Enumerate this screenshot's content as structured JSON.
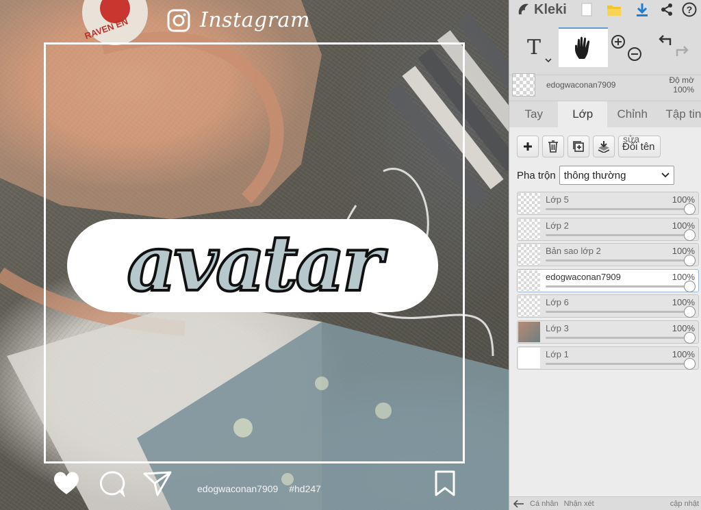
{
  "canvas": {
    "header": {
      "icon": "instagram-icon",
      "label": "Instagram"
    },
    "patch_text": "RAVEN EN",
    "sticker_text": "avatar",
    "footer": {
      "username": "edogwaconan7909",
      "hashtag": "#hd247"
    }
  },
  "panel": {
    "brand": "Kleki",
    "topbar_icons": [
      "new-file-icon",
      "folder-icon",
      "download-icon",
      "share-icon",
      "help-icon"
    ],
    "tools": {
      "text_glyph": "T"
    },
    "layer_header": {
      "name": "edogwaconan7909",
      "opacity_label": "Độ mờ",
      "opacity_value": "100%"
    },
    "tabs": [
      {
        "label": "Tay"
      },
      {
        "label": "Lớp"
      },
      {
        "label": "Chỉnh"
      },
      {
        "label": "Tập tin"
      }
    ],
    "rename_button": {
      "sub": "sửa",
      "label": "Đổi tên"
    },
    "blend": {
      "label": "Pha trộn",
      "value": "thông thường"
    },
    "layers": [
      {
        "name": "Lớp 5",
        "opacity": "100%"
      },
      {
        "name": "Lớp 2",
        "opacity": "100%"
      },
      {
        "name": "Bản sao lớp 2",
        "opacity": "100%"
      },
      {
        "name": "edogwaconan7909",
        "opacity": "100%"
      },
      {
        "name": "Lớp 6",
        "opacity": "100%"
      },
      {
        "name": "Lớp 3",
        "opacity": "100%"
      },
      {
        "name": "Lớp 1",
        "opacity": "100%"
      }
    ],
    "active_layer_index": 3,
    "bottombar": {
      "item1": "Cá nhân",
      "item2": "Nhận xét",
      "update": "cập nhật"
    }
  }
}
